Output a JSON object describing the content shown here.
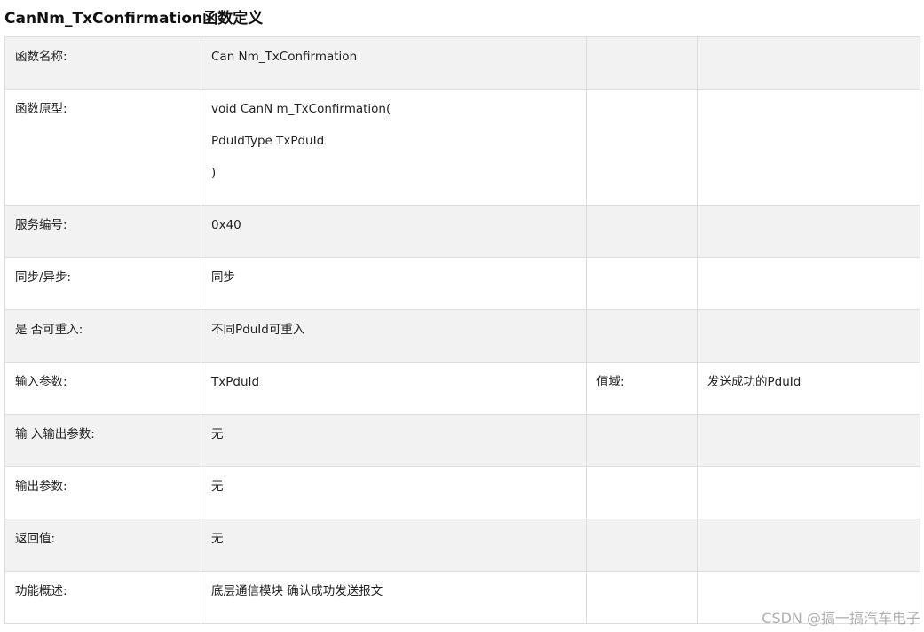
{
  "title": "CanNm_TxConfirmation函数定义",
  "rows": [
    {
      "label": "函数名称:",
      "value_lines": [
        "Can Nm_TxConfirmation"
      ],
      "extra_label": "",
      "extra_value": ""
    },
    {
      "label": "函数原型:",
      "value_lines": [
        "void CanN m_TxConfirmation(",
        "PduIdType TxPduId",
        ")"
      ],
      "extra_label": "",
      "extra_value": ""
    },
    {
      "label": "服务编号:",
      "value_lines": [
        "0x40"
      ],
      "extra_label": "",
      "extra_value": ""
    },
    {
      "label": "同步/异步:",
      "value_lines": [
        "同步"
      ],
      "extra_label": "",
      "extra_value": ""
    },
    {
      "label": "是 否可重入:",
      "value_lines": [
        "不同PduId可重入"
      ],
      "extra_label": "",
      "extra_value": ""
    },
    {
      "label": "输入参数:",
      "value_lines": [
        "TxPduId"
      ],
      "extra_label": "值域:",
      "extra_value": "发送成功的PduId"
    },
    {
      "label": "输 入输出参数:",
      "value_lines": [
        "无"
      ],
      "extra_label": "",
      "extra_value": ""
    },
    {
      "label": "输出参数:",
      "value_lines": [
        "无"
      ],
      "extra_label": "",
      "extra_value": ""
    },
    {
      "label": "返回值:",
      "value_lines": [
        "无"
      ],
      "extra_label": "",
      "extra_value": ""
    },
    {
      "label": "功能概述:",
      "value_lines": [
        "底层通信模块 确认成功发送报文"
      ],
      "extra_label": "",
      "extra_value": ""
    }
  ],
  "watermark": "CSDN @搞一搞汽车电子"
}
